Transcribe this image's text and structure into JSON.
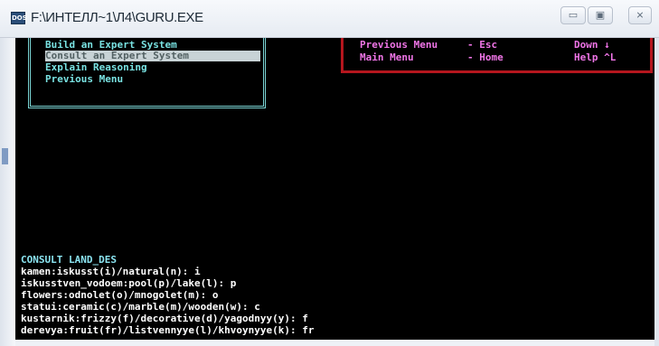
{
  "window": {
    "title": "F:\\ИНТЕЛЛ~1\\Л4\\GURU.EXE",
    "icon": "dos-app-icon",
    "controls": {
      "minimize": "▭",
      "maximize": "▣",
      "close": "⨯"
    }
  },
  "menu": {
    "items": [
      {
        "label": "Build an Expert System"
      },
      {
        "label": "Consult an Expert System"
      },
      {
        "label": "Explain Reasoning"
      },
      {
        "label": "Previous Menu"
      }
    ],
    "selected_index": 1
  },
  "help": {
    "rows": [
      {
        "left": "Previous Menu",
        "mid": "- Esc",
        "right": "Down ↓"
      },
      {
        "left": "Main Menu",
        "mid": "- Home",
        "right": "Help ^L"
      }
    ]
  },
  "console": {
    "title": "CONSULT LAND_DES",
    "lines": [
      "kamen:iskusst(i)/natural(n): i",
      "iskusstven_vodoem:pool(p)/lake(l): p",
      "flowers:odnolet(o)/mnogolet(m): o",
      "statui:ceramic(c)/marble(m)/wooden(w): c",
      "kustarnik:frizzy(f)/decorative(d)/yagodnyy(y): f",
      "derevya:fruit(fr)/listvennyye(l)/khvoynyye(k): fr"
    ]
  },
  "colors": {
    "console_bg": "#000000",
    "menu_text": "#79e2e2",
    "help_text": "#f075e7",
    "help_border": "#b5161e",
    "dialog_text": "#ffffff"
  }
}
